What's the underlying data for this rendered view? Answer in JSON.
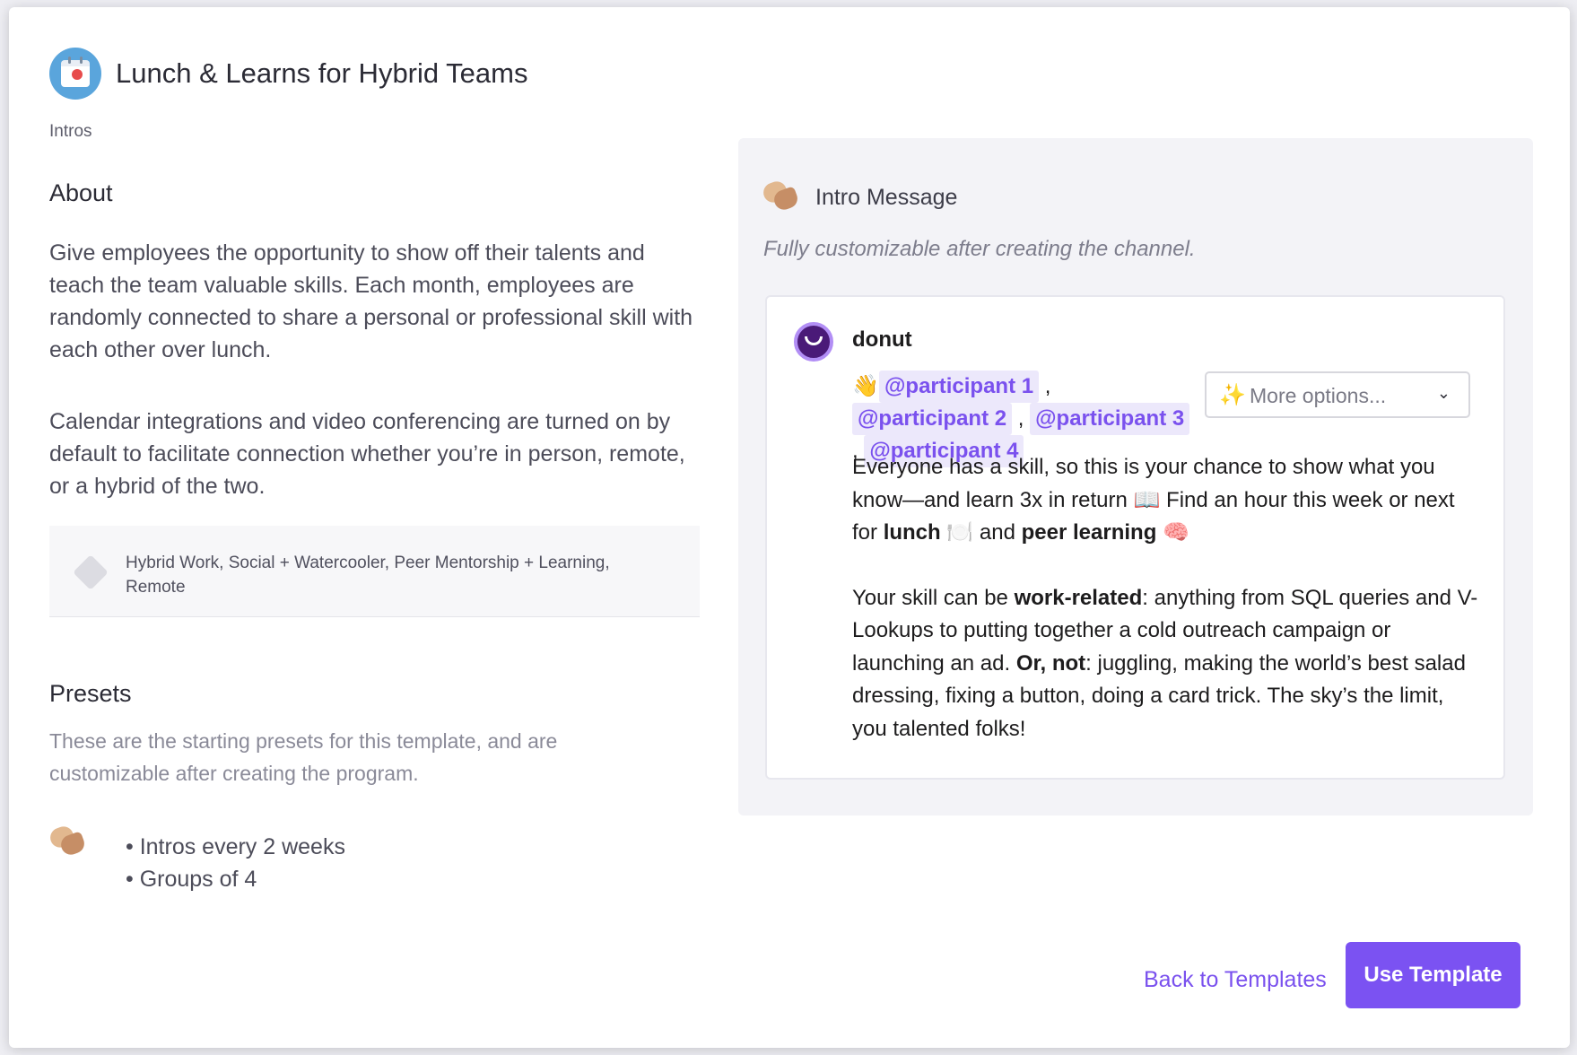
{
  "header": {
    "title": "Lunch & Learns for Hybrid Teams",
    "category": "Intros"
  },
  "about": {
    "heading": "About",
    "paragraph1": "Give employees the opportunity to show off their talents and teach the team valuable skills. Each month, employees are randomly connected to share a personal or professional skill with each other over lunch.",
    "paragraph2": "Calendar integrations and video conferencing are turned on by default to facilitate connection whether you’re in person, remote, or a hybrid of the two.",
    "tags": "Hybrid Work, Social + Watercooler, Peer Mentorship + Learning, Remote"
  },
  "presets": {
    "heading": "Presets",
    "description": "These are the starting presets for this template, and are customizable after creating the program.",
    "items": [
      "Intros every 2 weeks",
      "Groups of 4"
    ]
  },
  "intro_message": {
    "heading": "Intro Message",
    "subtitle": "Fully customizable after creating the channel.",
    "bot_name": "donut",
    "mentions": [
      "@participant 1",
      "@participant 2",
      "@participant 3",
      "@participant 4"
    ],
    "dropdown_label": "More options...",
    "body": {
      "p1_a": "Everyone has a skill, so this is your chance to show what you know—and learn 3x in return ",
      "p1_book": "📖",
      "p1_b": " Find an hour this week or next for ",
      "p1_lunch": "lunch",
      "p1_plate": "🍽️",
      "p1_c": " and ",
      "p1_peer": "peer learning",
      "p1_brain": "🧠",
      "p2_a": "Your skill can be ",
      "p2_work": "work-related",
      "p2_b": ": anything from SQL queries and V-Lookups to putting together a cold outreach campaign or launching an ad. ",
      "p2_ornot": "Or, not",
      "p2_c": ": juggling, making the world’s best salad dressing, fixing a button, doing a card trick. The sky’s the limit, you talented folks!"
    }
  },
  "footer": {
    "back_label": "Back to Templates",
    "use_label": "Use Template"
  },
  "colors": {
    "accent": "#7b52f2",
    "mention_bg": "#ece8fb",
    "panel_bg": "#f3f3f7"
  }
}
